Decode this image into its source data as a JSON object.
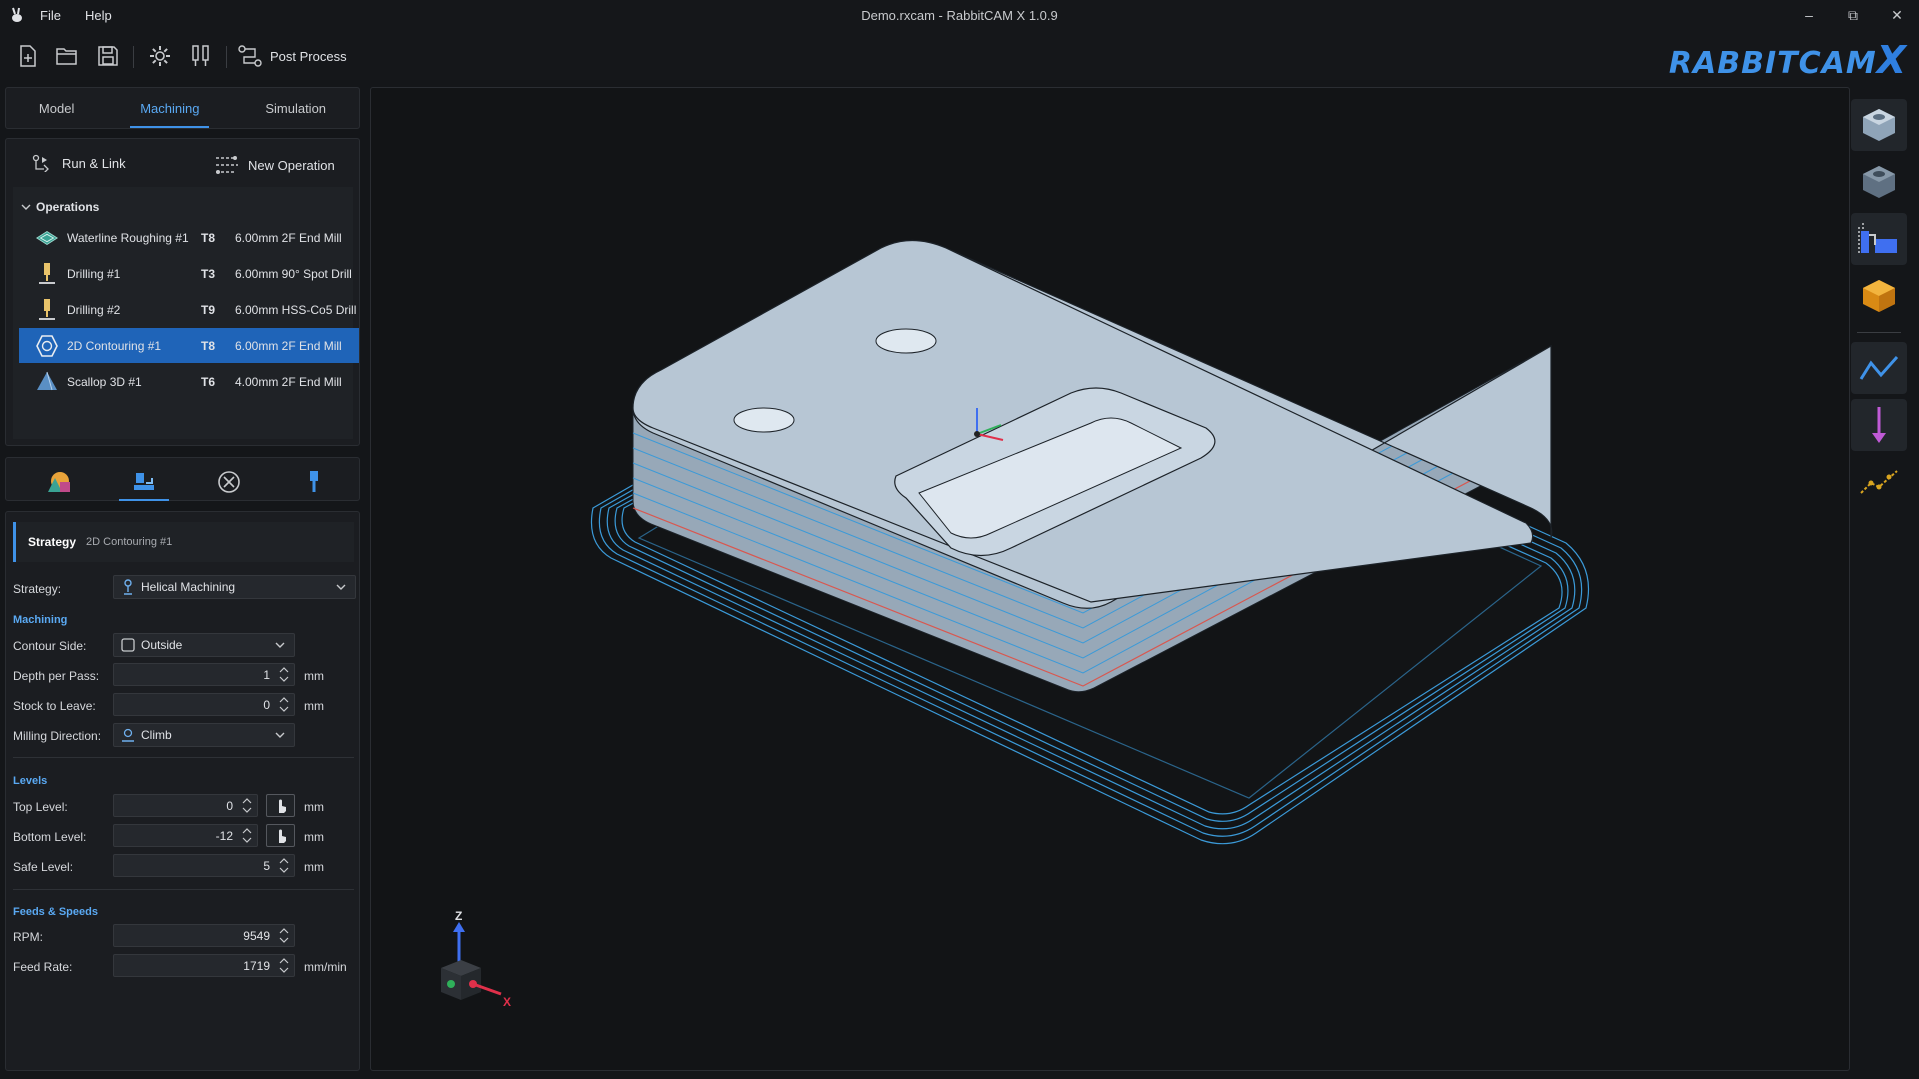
{
  "window": {
    "title": "Demo.rxcam - RabbitCAM X 1.0.9"
  },
  "menu": {
    "file": "File",
    "help": "Help"
  },
  "toolbar": {
    "post_process": "Post Process"
  },
  "brand": {
    "name": "RABBITCAM",
    "suffix": "X"
  },
  "tabs": {
    "model": "Model",
    "machining": "Machining",
    "simulation": "Simulation"
  },
  "ops_panel": {
    "run_link": "Run & Link",
    "new_operation": "New Operation",
    "header": "Operations",
    "items": [
      {
        "name": "Waterline Roughing #1",
        "tool": "T8",
        "desc": "6.00mm 2F End Mill",
        "icon": "waterline-icon"
      },
      {
        "name": "Drilling #1",
        "tool": "T3",
        "desc": "6.00mm 90° Spot Drill",
        "icon": "drill-icon"
      },
      {
        "name": "Drilling #2",
        "tool": "T9",
        "desc": "6.00mm HSS-Co5 Drill",
        "icon": "drill-icon"
      },
      {
        "name": "2D Contouring #1",
        "tool": "T8",
        "desc": "6.00mm 2F End Mill",
        "icon": "contour-icon"
      },
      {
        "name": "Scallop 3D #1",
        "tool": "T6",
        "desc": "4.00mm 2F End Mill",
        "icon": "scallop-icon"
      }
    ],
    "selected_index": 3
  },
  "props": {
    "strategy_title": "Strategy",
    "strategy_sub": "2D Contouring #1",
    "strategy_label": "Strategy:",
    "strategy_value": "Helical Machining",
    "machining_section": "Machining",
    "contour_side_label": "Contour Side:",
    "contour_side_value": "Outside",
    "depth_label": "Depth per Pass:",
    "depth_value": "1",
    "stock_label": "Stock to Leave:",
    "stock_value": "0",
    "milling_dir_label": "Milling Direction:",
    "milling_dir_value": "Climb",
    "levels_section": "Levels",
    "top_label": "Top Level:",
    "top_value": "0",
    "bottom_label": "Bottom Level:",
    "bottom_value": "-12",
    "safe_label": "Safe Level:",
    "safe_value": "5",
    "feeds_section": "Feeds & Speeds",
    "rpm_label": "RPM:",
    "rpm_value": "9549",
    "feed_label": "Feed Rate:",
    "feed_value": "1719",
    "unit_mm": "mm",
    "unit_mmmin": "mm/min"
  },
  "axes": {
    "z": "Z",
    "x": "X"
  },
  "colors": {
    "accent": "#3f92e8",
    "selection": "#1f64b8",
    "toolpath": "#3b9ad8",
    "part": "#a9b8c6"
  }
}
